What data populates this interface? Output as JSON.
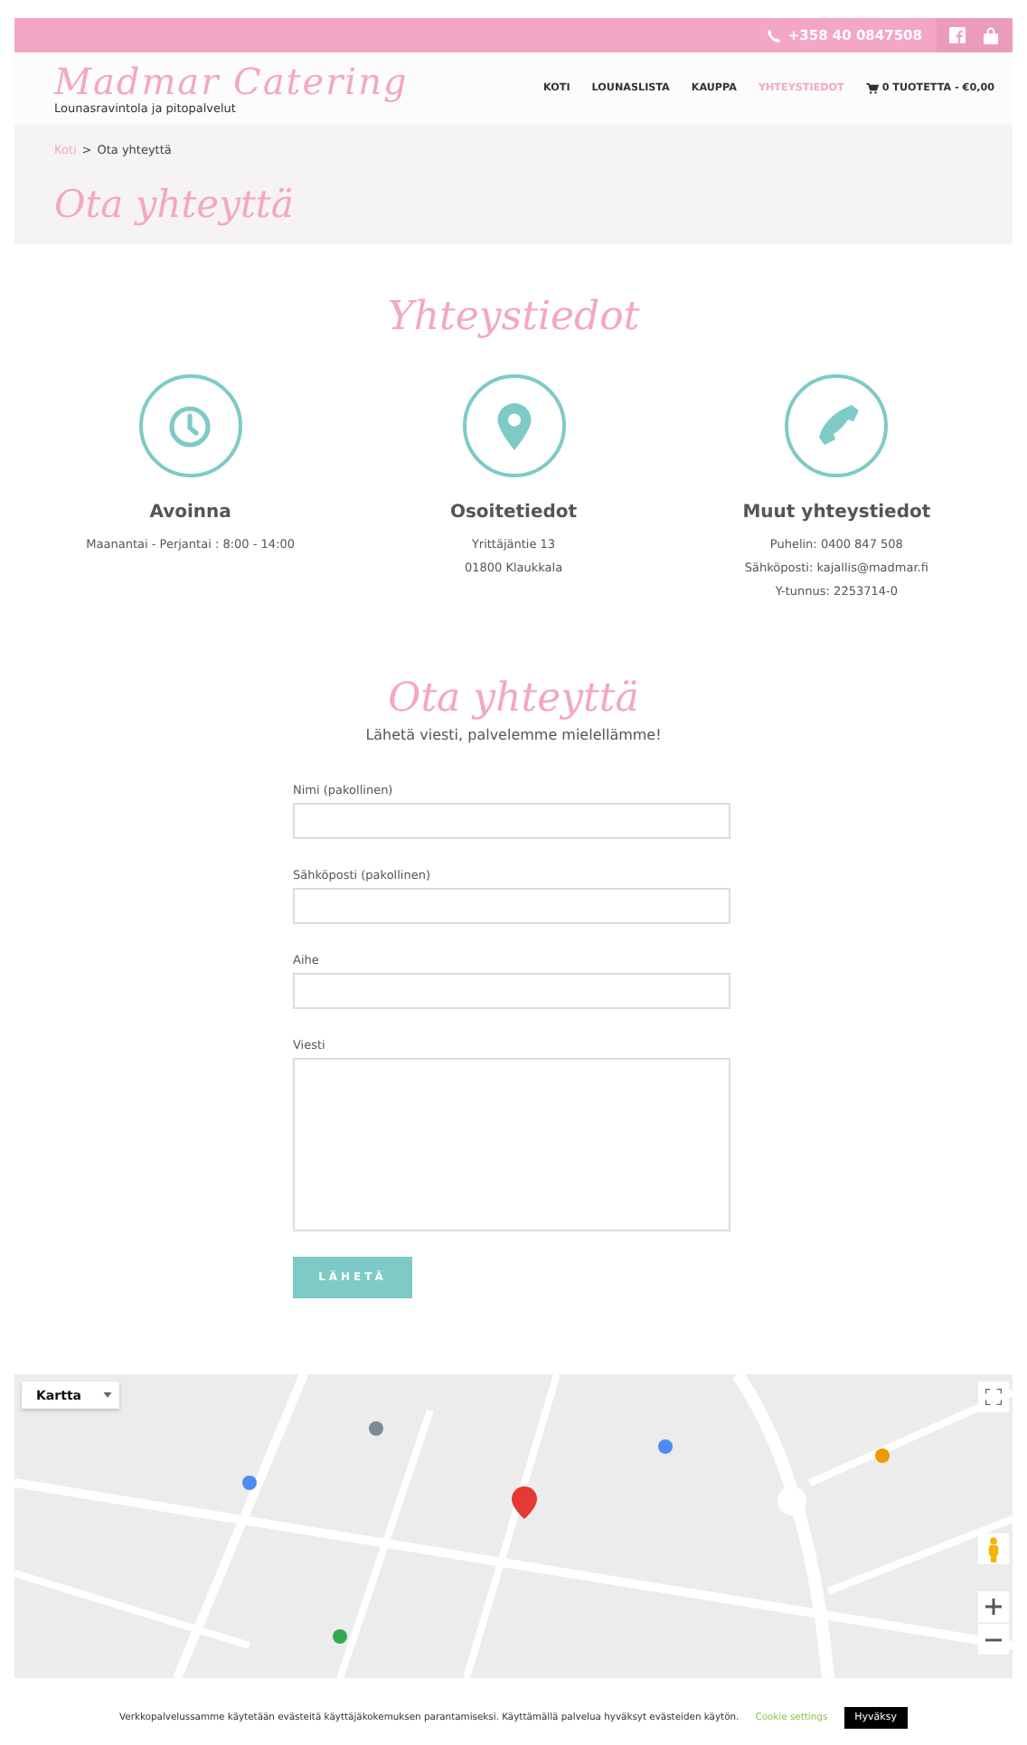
{
  "topbar": {
    "phone": "+358 40 0847508"
  },
  "header": {
    "logo": "Madmar Catering",
    "tagline": "Lounasravintola ja pitopalvelut",
    "nav": [
      {
        "label": "KOTI",
        "selected": false
      },
      {
        "label": "LOUNASLISTA",
        "selected": false
      },
      {
        "label": "KAUPPA",
        "selected": false
      },
      {
        "label": "YHTEYSTIEDOT",
        "selected": true
      }
    ],
    "cart": "0 TUOTETTA - €0,00"
  },
  "breadcrumb": {
    "home": "Koti",
    "separator": ">",
    "current": "Ota yhteyttä"
  },
  "page_title": "Ota yhteyttä",
  "contact": {
    "heading": "Yhteystiedot",
    "columns": [
      {
        "kind": "clock",
        "title": "Avoinna",
        "lines": [
          "Maanantai - Perjantai : 8:00 - 14:00"
        ]
      },
      {
        "kind": "pin",
        "title": "Osoitetiedot",
        "lines": [
          "Yrittäjäntie 13",
          "01800 Klaukkala"
        ]
      },
      {
        "kind": "phone",
        "title": "Muut yhteystiedot",
        "lines": [
          "Puhelin: 0400 847 508",
          "Sähköposti: kajallis@madmar.fi",
          "Y-tunnus: 2253714-0"
        ]
      }
    ]
  },
  "form": {
    "heading": "Ota yhteyttä",
    "subtitle": "Lähetä viesti, palvelemme mielellämme!",
    "fields": [
      {
        "kind": "input",
        "label": "Nimi (pakollinen)"
      },
      {
        "kind": "input",
        "label": "Sähköposti (pakollinen)"
      },
      {
        "kind": "input",
        "label": "Aihe"
      },
      {
        "kind": "textarea",
        "label": "Viesti"
      }
    ],
    "submit": "LÄHETÄ"
  },
  "map": {
    "kind": "picture",
    "type_select": "Kartta"
  },
  "cookie": {
    "text": "Verkkopalvelussamme käytetään evästeitä käyttäjäkokemuksen parantamiseksi. Käyttämällä palvelua hyväksyt evästeiden käytön.",
    "settings": "Cookie settings",
    "accept": "Hyväksy"
  }
}
